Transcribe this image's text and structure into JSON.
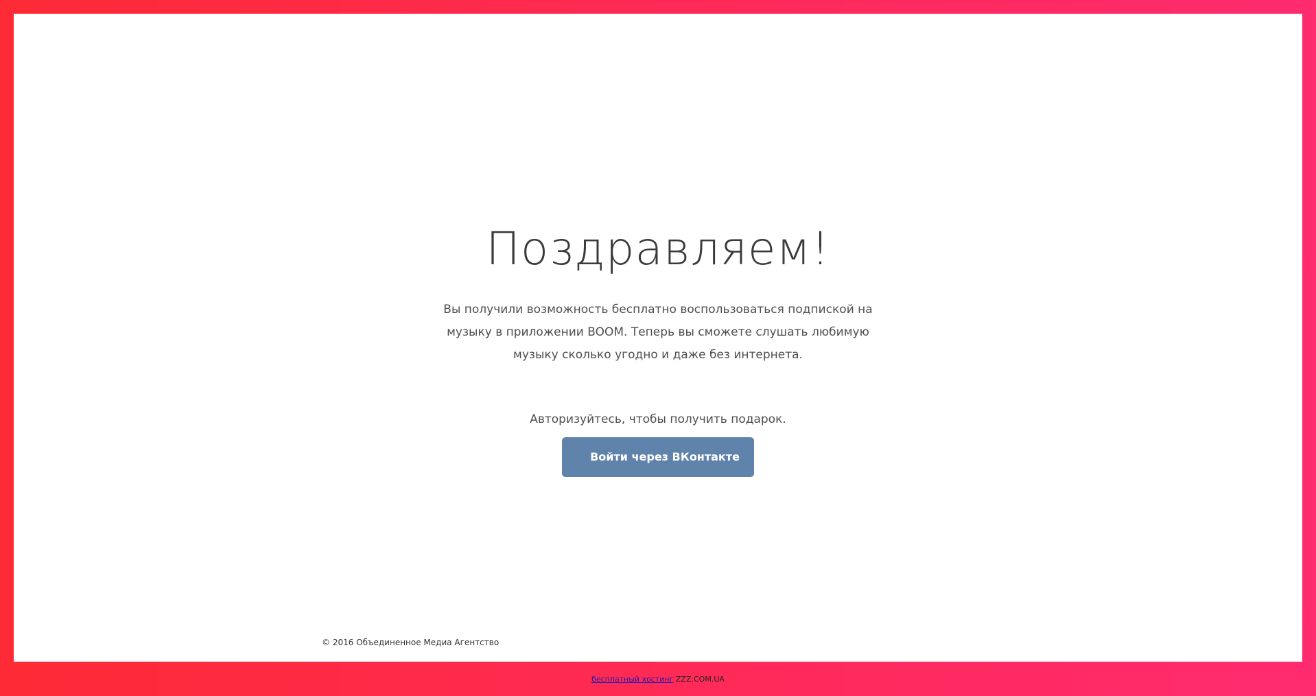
{
  "main": {
    "title": "Поздравляем!",
    "description": "Вы получили возможность бесплатно воспользоваться подпиской на музыку в приложении BOOM. Теперь вы сможете слушать любимую музыку сколько угодно и даже без интернета.",
    "auth_prompt": "Авторизуйтесь, чтобы получить подарок.",
    "login_button_label": "Войти через ВКонтакте"
  },
  "footer": {
    "copyright": "© 2016 Объединенное Медиа Агентство",
    "hosting_link_text": "бесплатный хостинг",
    "hosting_brand": "ZZZ.COM.UA"
  },
  "colors": {
    "frame_gradient_start": "#fe2a35",
    "frame_gradient_end": "#ff2b6f",
    "button_background": "#5f83aa",
    "card_background": "#ffffff"
  }
}
